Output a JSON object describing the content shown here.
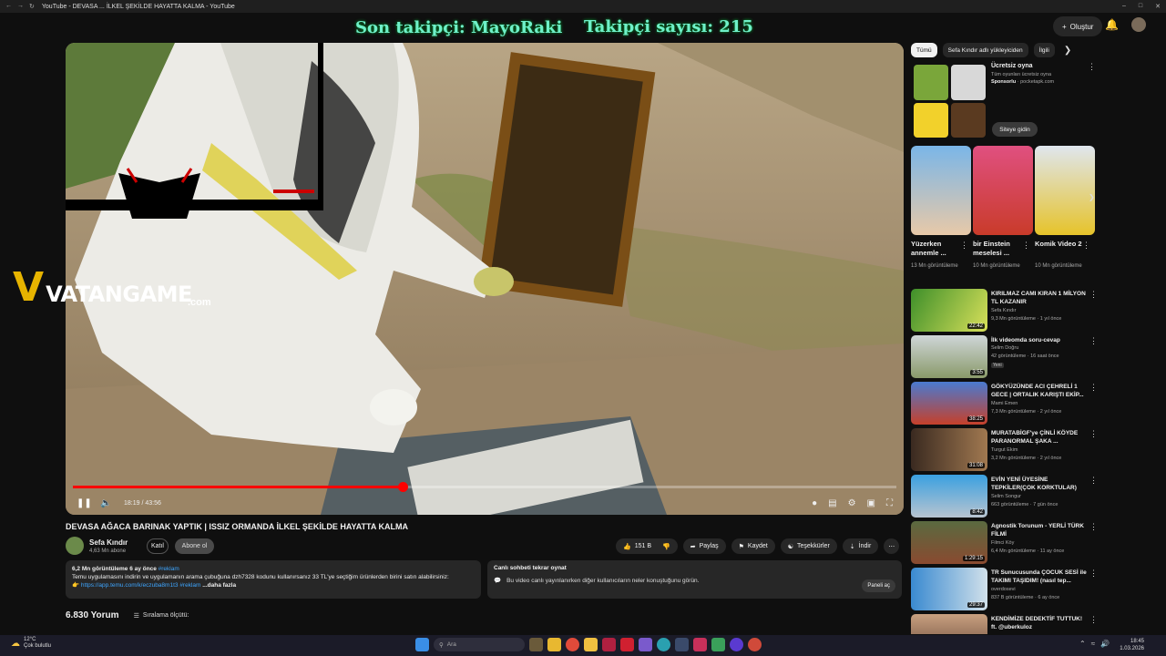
{
  "browser": {
    "tab_title": "YouTube - DEVASA ... İLKEL ŞEKİLDE HAYATTA KALMA - YouTube",
    "back_icon": "arrow-left-icon",
    "forward_icon": "arrow-right-icon",
    "reload_icon": "reload-icon"
  },
  "header": {
    "create_label": "Oluştur",
    "notifications_icon": "bell-icon"
  },
  "stream_overlay": {
    "last_follower": "Son takipçi: MayoRaki",
    "follower_count": "Takipçi sayısı: 215",
    "logo_v": "V",
    "logo_word": "VATANGAME",
    "logo_suffix": ".com"
  },
  "player": {
    "current_time": "18:19",
    "separator": "/",
    "duration": "43:56",
    "progress_fraction": 0.4,
    "accent": "#ff0000"
  },
  "video": {
    "title": "DEVASA AĞACA BARINAK YAPTIK | ISSIZ ORMANDA İLKEL ŞEKİLDE HAYATTA KALMA",
    "channel_name": "Sefa Kındır",
    "channel_subs": "4,63 Mn abone",
    "join_label": "Katıl",
    "subscribed_label": "Abone ol",
    "likes": "151 B",
    "share_label": "Paylaş",
    "save_label": "Kaydet",
    "thanks_label": "Teşekkürler",
    "download_label": "İndir"
  },
  "description": {
    "stats": "6,2 Mn görüntüleme  6 ay önce",
    "hashtag": "#reklam",
    "line1": "Temu uygulamasını indirin ve uygulamanın arama çubuğuna dzh7328 kodunu kullanırsanız 33 TL'ye seçtiğim ürünlerden birini satın alabilirsiniz:",
    "link": "https://app.temu.com/k/eczuba8m1t3",
    "link_hashtag": "#reklam",
    "more": "...daha fazla"
  },
  "live_chat": {
    "title": "Canlı sohbeti tekrar oynat",
    "body": "Bu video canlı yayınlanırken diğer kullanıcıların neler konuştuğunu görün.",
    "open_label": "Paneli aç"
  },
  "comments": {
    "count": "6.830 Yorum",
    "sort_label": "Sıralama ölçütü:"
  },
  "sidebar": {
    "chips": [
      "Tümü",
      "Sefa Kındır adlı yükleyiciden",
      "İlgili"
    ],
    "ad": {
      "title": "Ücretsiz oyna",
      "subtitle": "Tüm oyunları ücretsiz oyna",
      "sponsored": "Sponsorlu",
      "domain": "· pocketapk.com",
      "visit_label": "Siteye gidin"
    },
    "shorts": [
      {
        "title": "Yüzerken annemle ...",
        "views": "13 Mn görüntüleme"
      },
      {
        "title": "bir Einstein meselesi ...",
        "views": "10 Mn görüntüleme"
      },
      {
        "title": "Komik Video 2",
        "views": "10 Mn görüntüleme"
      }
    ],
    "videos": [
      {
        "title": "KIRILMAZ CAMI KIRAN 1 MİLYON TL KAZANIR",
        "channel": "Sefa Kındır",
        "meta": "9,3 Mn görüntüleme · 1 yıl önce",
        "duration": "22:42",
        "badge": ""
      },
      {
        "title": "İlk videomda soru-cevap",
        "channel": "Selim Doğru",
        "meta": "42 görüntüleme · 16 saat önce",
        "duration": "3:55",
        "badge": "Yeni"
      },
      {
        "title": "GÖKYÜZÜNDE ACI ÇEHRELİ 1 GECE | ORTALIK KARIŞTI EKİP...",
        "channel": "Mami Emen",
        "meta": "7,3 Mn görüntüleme · 2 yıl önce",
        "duration": "38:25",
        "badge": ""
      },
      {
        "title": "MURATABİGF'ye ÇİNLİ KÖYDE PARANORMAL ŞAKA ...",
        "channel": "Turgut Ekim",
        "meta": "3,2 Mn görüntüleme · 2 yıl önce",
        "duration": "31:08",
        "badge": ""
      },
      {
        "title": "EVİN YENİ ÜYESİNE TEPKİLER(ÇOK KORKTULAR)",
        "channel": "Selim Songur",
        "meta": "663 görüntüleme · 7 gün önce",
        "duration": "8:42",
        "badge": ""
      },
      {
        "title": "Agnostik Torunum - YERLİ TÜRK FİLMİ",
        "channel": "Filmci Köy",
        "meta": "6,4 Mn görüntüleme · 11 ay önce",
        "duration": "1:29:15",
        "badge": ""
      },
      {
        "title": "TR Sunucusunda ÇOCUK SESİ ile TAKIMI TAŞIDIM! (nasıl tep...",
        "channel": "overdosevi",
        "meta": "837 B görüntüleme · 6 ay önce",
        "duration": "29:37",
        "badge": ""
      },
      {
        "title": "KENDİMİZE DEDEKTİF TUTTUK! ft. @uberkuloz",
        "channel": "",
        "meta": "",
        "duration": "",
        "badge": ""
      }
    ]
  },
  "taskbar": {
    "temperature": "12°C",
    "weather": "Çok bulutlu",
    "search_placeholder": "Ara",
    "time": "18:45",
    "date": "1.03.2026"
  }
}
